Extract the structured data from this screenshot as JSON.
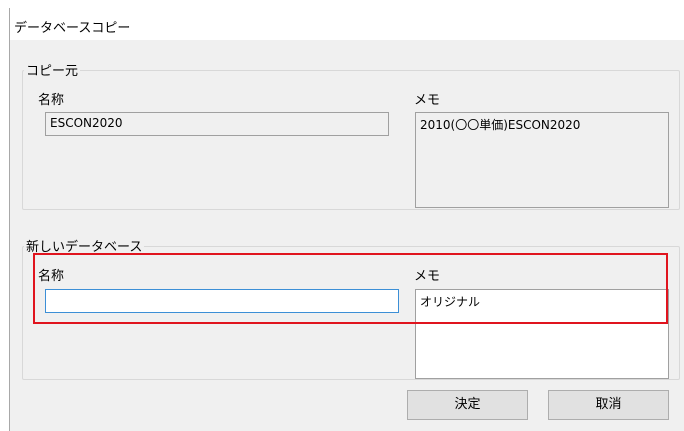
{
  "window": {
    "title": "データベースコピー"
  },
  "source_group": {
    "label": "コピー元",
    "name_label": "名称",
    "name_value": "ESCON2020",
    "memo_label": "メモ",
    "memo_value": "2010(〇〇単価)ESCON2020"
  },
  "new_group": {
    "label": "新しいデータベース",
    "name_label": "名称",
    "name_value": "",
    "memo_label": "メモ",
    "memo_value": "オリジナル"
  },
  "buttons": {
    "ok": "決定",
    "cancel": "取消"
  },
  "colors": {
    "highlight": "#e0141e",
    "focus_border": "#3c8fd6"
  }
}
